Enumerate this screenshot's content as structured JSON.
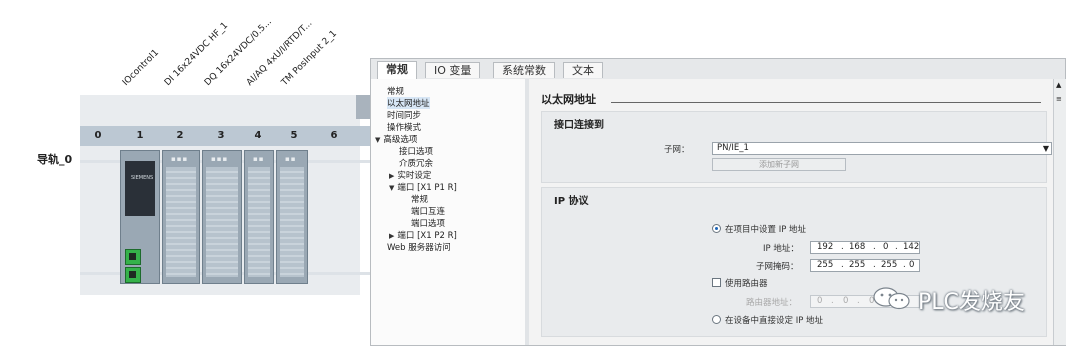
{
  "device_view": {
    "module_labels": [
      "IOcontrol1",
      "DI 16x24VDC HF_1",
      "DQ 16x24VDC/0.5...",
      "AI/AQ 4xU/I/RTD/T...",
      "TM PosInput 2_1"
    ],
    "slot_numbers": [
      "0",
      "1",
      "2",
      "3",
      "4",
      "5",
      "6"
    ],
    "rail_label": "导轨_0",
    "cpu_brand": "SIEMENS"
  },
  "properties": {
    "tabs": [
      "常规",
      "IO 变量",
      "系统常数",
      "文本"
    ],
    "nav": {
      "general": "常规",
      "ethernet_address": "以太网地址",
      "time_sync": "时间同步",
      "operating_mode": "操作模式",
      "advanced_options": "高级选项",
      "interface_options": "接口选项",
      "media_redundancy": "介质冗余",
      "realtime_settings": "实时设定",
      "port_p1": "端口 [X1 P1 R]",
      "port_p1_general": "常规",
      "port_p1_interconnect": "端口互连",
      "port_p1_options": "端口选项",
      "port_p2": "端口 [X1 P2 R]",
      "web_access": "Web 服务器访问"
    },
    "section_title": "以太网地址",
    "interface_group": {
      "title": "接口连接到",
      "subnet_label": "子网：",
      "subnet_value": "PN/IE_1",
      "add_subnet_button": "添加新子网"
    },
    "ip_group": {
      "title": "IP 协议",
      "set_in_project_label": "在项目中设置 IP 地址",
      "ip_label": "IP 地址：",
      "ip_octets": [
        "192",
        "168",
        "0",
        "142"
      ],
      "mask_label": "子网掩码：",
      "mask_octets": [
        "255",
        "255",
        "255",
        "0"
      ],
      "use_router_label": "使用路由器",
      "router_label": "路由器地址：",
      "router_octets": [
        "0",
        "0",
        "0",
        "0"
      ],
      "set_on_device_label": "在设备中直接设定 IP 地址"
    }
  },
  "watermark": {
    "text": "PLC发烧友"
  }
}
